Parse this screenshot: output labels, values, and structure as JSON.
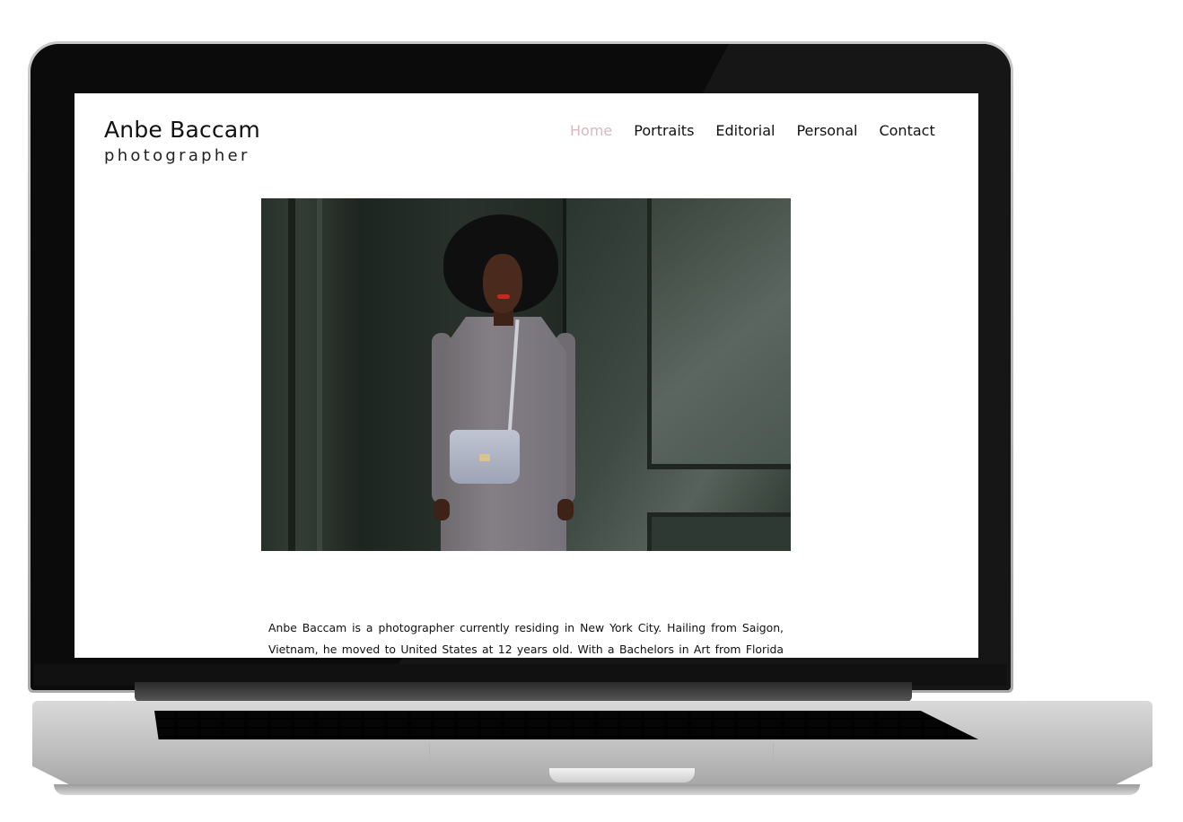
{
  "site": {
    "brand_name": "Anbe Baccam",
    "brand_tagline": "photographer"
  },
  "nav": {
    "items": [
      {
        "label": "Home",
        "active": true
      },
      {
        "label": "Portraits",
        "active": false
      },
      {
        "label": "Editorial",
        "active": false
      },
      {
        "label": "Personal",
        "active": false
      },
      {
        "label": "Contact",
        "active": false
      }
    ]
  },
  "hero": {
    "image_subject": "portrait of a woman in a grey trench coat with a shoulder bag in front of a dark green door"
  },
  "bio": {
    "text": "Anbe Baccam is a photographer currently residing in New York City. Hailing from Saigon, Vietnam, he moved to United States at 12 years old. With a Bachelors in Art from Florida International"
  },
  "colors": {
    "nav_active": "#d8b9bd",
    "text": "#111111",
    "background": "#ffffff"
  }
}
